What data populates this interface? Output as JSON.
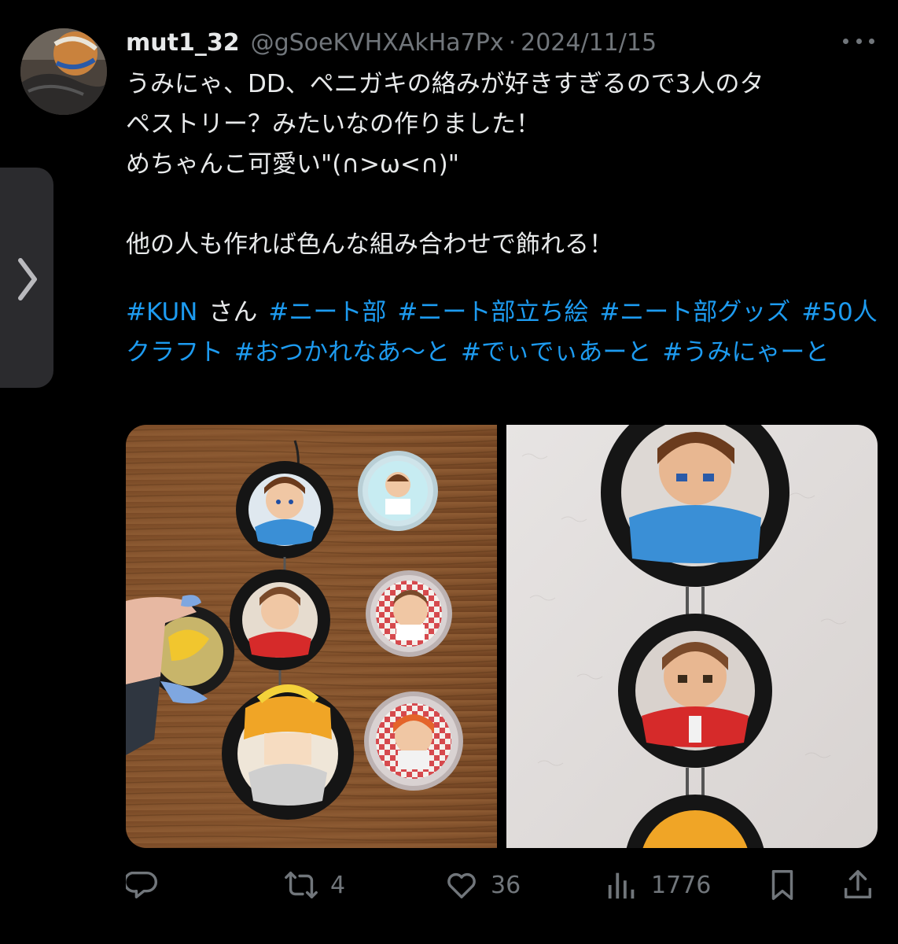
{
  "tweet": {
    "display_name": "mut1_32",
    "handle": "@gSoeKVHXAkHa7Px",
    "separator": "·",
    "date": "2024/11/15",
    "body": "うみにゃ、DD、ペニガキの絡みが好きすぎるので3人のタ\nペストリー？みたいなの作りました！\nめちゃんこ可愛い\"(∩>ω<∩)\"\n\n他の人も作れば色んな組み合わせで飾れる！",
    "hashtags_line": [
      {
        "text": "#KUN",
        "kind": "tag"
      },
      {
        "text": "さん",
        "kind": "plain"
      },
      {
        "text": "#ニート部",
        "kind": "tag"
      },
      {
        "text": "#ニート部立ち絵",
        "kind": "tag"
      },
      {
        "text": "#ニート部グッズ",
        "kind": "tag"
      },
      {
        "text": "#50人クラフト",
        "kind": "tag"
      },
      {
        "text": "#おつかれなあ～と",
        "kind": "tag"
      },
      {
        "text": "#でぃでぃあーと",
        "kind": "tag"
      },
      {
        "text": "#うみにゃーと",
        "kind": "tag"
      }
    ]
  },
  "actions": {
    "reply_icon": "reply-icon",
    "retweet_icon": "retweet-icon",
    "retweet_count": "4",
    "like_icon": "heart-icon",
    "like_count": "36",
    "views_icon": "views-icon",
    "views_count": "1776",
    "bookmark_icon": "bookmark-icon",
    "share_icon": "share-icon"
  },
  "colors": {
    "background": "#000000",
    "text": "#e7e9ea",
    "muted": "#71767b",
    "link": "#1d9bf0"
  }
}
